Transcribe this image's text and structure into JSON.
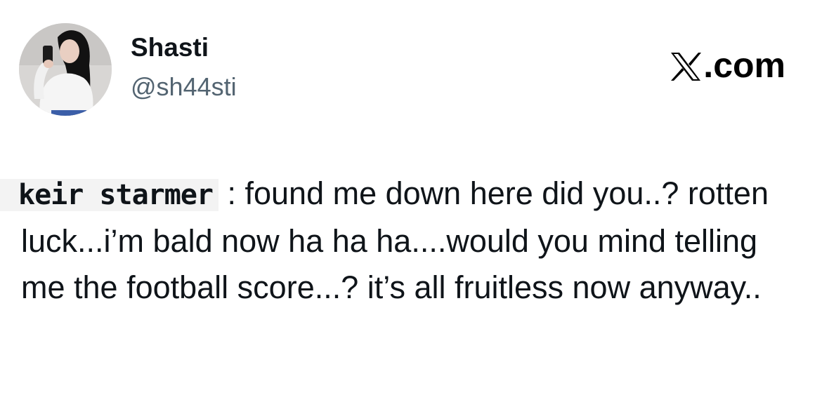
{
  "author": {
    "display_name": "Shasti",
    "handle": "@sh44sti",
    "avatar_icon": "profile-photo"
  },
  "brand": {
    "logo_icon": "x-logo-icon",
    "label": ".com"
  },
  "tweet": {
    "speaker": "keir starmer",
    "body": " : found me down here did you..? rotten luck...i’m bald now ha ha ha....would you mind telling me the football score...? it’s all fruitless now anyway.."
  },
  "colors": {
    "text": "#0f1419",
    "handle": "#536471",
    "background": "#ffffff"
  }
}
